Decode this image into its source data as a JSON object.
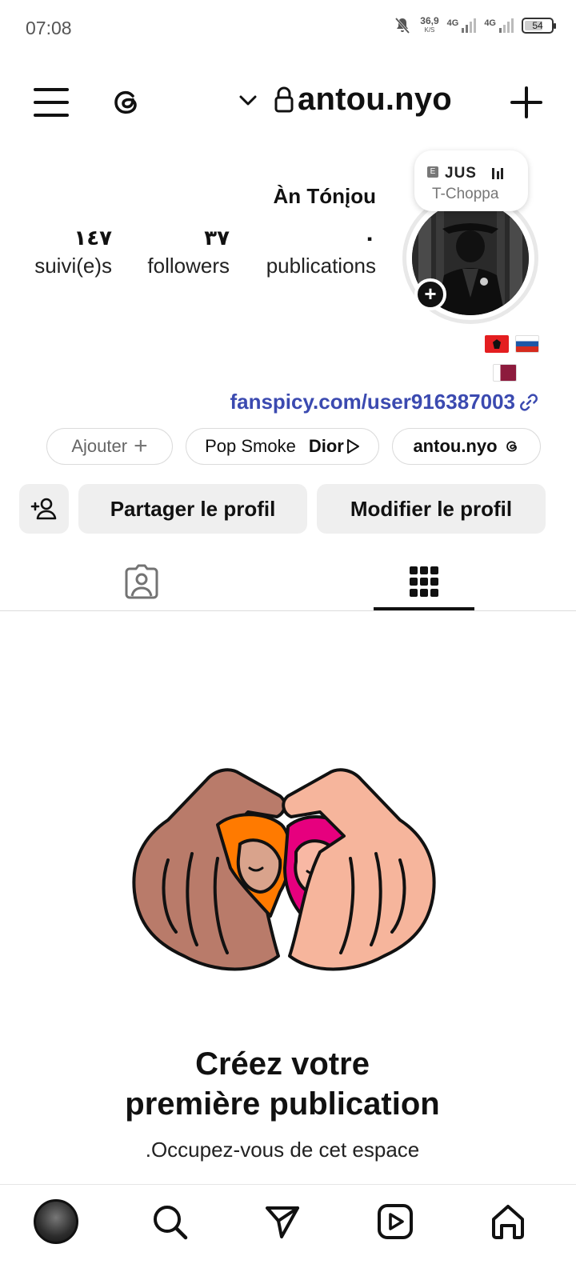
{
  "status_bar": {
    "time": "07:08",
    "net_speed": "36,9",
    "net_unit": "K/S",
    "sim1": "4G",
    "sim2": "4G",
    "battery": "54"
  },
  "header": {
    "username": "antou.nyo"
  },
  "profile": {
    "display_name": "Àn Tónįou",
    "stats": [
      {
        "value": "١٤٧",
        "label": "suivi(e)s"
      },
      {
        "value": "٣٧",
        "label": "followers"
      },
      {
        "value": "٠",
        "label": "publications"
      }
    ],
    "note_title": "JUS",
    "note_subtitle": "T-Choppa",
    "note_badge": "E",
    "link": "fanspicy.com/user916387003"
  },
  "chips": {
    "add_label": "Ajouter",
    "add_plus": "+",
    "music_artist": "Pop Smoke",
    "music_track": "Dior",
    "threads_label": "antou.nyo"
  },
  "actions": {
    "share_label": "Partager le profil",
    "edit_label": "Modifier le profil"
  },
  "empty_state": {
    "title_line1": "Créez votre",
    "title_line2": "première publication",
    "subtitle": ".Occupez-vous de cet espace"
  },
  "colors": {
    "link": "#3b4ab0",
    "button_bg": "#efefef",
    "orange_hair": "#ff7a00",
    "pink_hair": "#e6007e"
  },
  "icons": {
    "header": [
      "menu-icon",
      "threads-icon",
      "chevron-down-icon",
      "lock-icon",
      "plus-icon"
    ],
    "tabs": [
      "tagged-icon",
      "grid-icon"
    ],
    "nav": [
      "profile-avatar",
      "search-icon",
      "direct-icon",
      "reels-icon",
      "home-icon"
    ]
  }
}
